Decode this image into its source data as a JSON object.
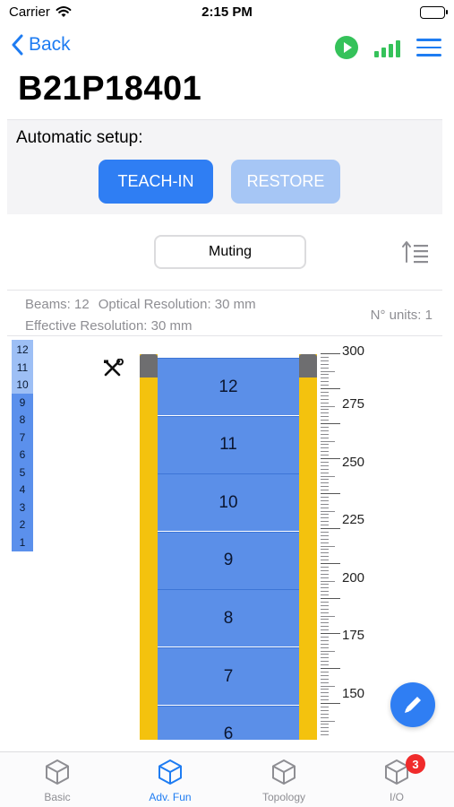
{
  "status": {
    "carrier": "Carrier",
    "time": "2:15 PM"
  },
  "nav": {
    "back_label": "Back",
    "device_id": "B21P18401"
  },
  "setup": {
    "label": "Automatic setup:",
    "teach_in": "TEACH-IN",
    "restore": "RESTORE"
  },
  "mode": {
    "label": "Muting"
  },
  "info": {
    "beams": "Beams: 12",
    "optical_resolution": "Optical Resolution: 30 mm",
    "effective_resolution": "Effective Resolution: 30 mm",
    "units": "N° units: 1"
  },
  "beam_index": [
    "12",
    "11",
    "10",
    "9",
    "8",
    "7",
    "6",
    "5",
    "4",
    "3",
    "2",
    "1"
  ],
  "beams": [
    "12",
    "11",
    "10",
    "9",
    "8",
    "7",
    "6"
  ],
  "scale": [
    "300",
    "275",
    "250",
    "225",
    "200",
    "175",
    "150"
  ],
  "tabs": [
    {
      "label": "Basic",
      "icon": "cube-icon"
    },
    {
      "label": "Adv. Fun",
      "icon": "cube-icon"
    },
    {
      "label": "Topology",
      "icon": "cube-icon"
    },
    {
      "label": "I/O",
      "icon": "cube-icon",
      "badge": "3"
    }
  ],
  "colors": {
    "accent": "#2f7ef3",
    "beam": "#5b8fe8",
    "rail": "#f4c20e",
    "green": "#35c25a",
    "badge": "#f02b2b"
  }
}
